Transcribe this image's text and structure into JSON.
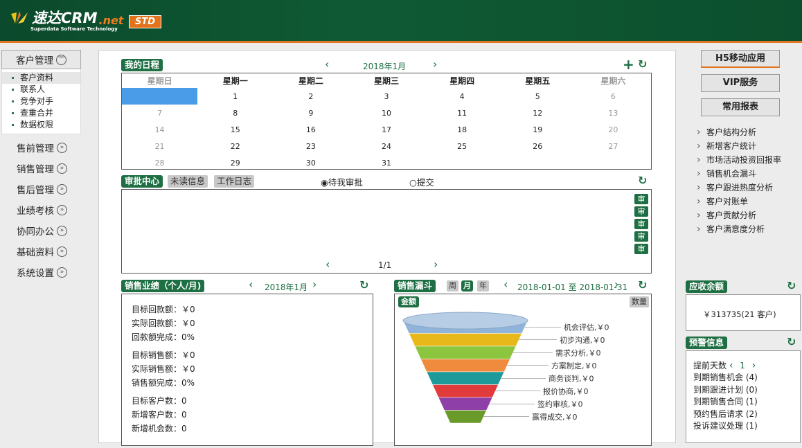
{
  "header": {
    "logo_text": "速达CRM",
    "logo_net": ".net",
    "logo_sub": "Superdata Software Technology",
    "edition": "STD"
  },
  "left_menu": {
    "active": {
      "label": "客户管理"
    },
    "sub_items": [
      {
        "label": "客户资料"
      },
      {
        "label": "联系人"
      },
      {
        "label": "竞争对手"
      },
      {
        "label": "查重合并"
      },
      {
        "label": "数据权限"
      }
    ],
    "items": [
      {
        "label": "售前管理"
      },
      {
        "label": "销售管理"
      },
      {
        "label": "售后管理"
      },
      {
        "label": "业绩考核"
      },
      {
        "label": "协同办公"
      },
      {
        "label": "基础资料"
      },
      {
        "label": "系统设置"
      }
    ]
  },
  "schedule": {
    "title": "我的日程",
    "month": "2018年1月",
    "weekdays": [
      "星期日",
      "星期一",
      "星期二",
      "星期三",
      "星期四",
      "星期五",
      "星期六"
    ],
    "weeks": [
      [
        "",
        "1",
        "2",
        "3",
        "4",
        "5",
        "6"
      ],
      [
        "7",
        "8",
        "9",
        "10",
        "11",
        "12",
        "13"
      ],
      [
        "14",
        "15",
        "16",
        "17",
        "18",
        "19",
        "20"
      ],
      [
        "21",
        "22",
        "23",
        "24",
        "25",
        "26",
        "27"
      ],
      [
        "28",
        "29",
        "30",
        "31",
        "",
        "",
        ""
      ]
    ]
  },
  "approval": {
    "title": "审批中心",
    "tab_unread": "未读信息",
    "tab_log": "工作日志",
    "radio_pending": "待我审批",
    "radio_submit": "提交",
    "shen_label": "审",
    "page": "1/1"
  },
  "sales_perf": {
    "title": "销售业绩（个人/月)",
    "month": "2018年1月",
    "rows": [
      {
        "label": "目标回款额：",
        "value": "￥0"
      },
      {
        "label": "实际回款额：",
        "value": "￥0"
      },
      {
        "label": "回款额完成：",
        "value": "0%"
      },
      {
        "label": "目标销售额：",
        "value": "￥0"
      },
      {
        "label": "实际销售额：",
        "value": "￥0"
      },
      {
        "label": "销售额完成：",
        "value": "0%"
      },
      {
        "label": "目标客户数：",
        "value": "0"
      },
      {
        "label": "新增客户数：",
        "value": "0"
      },
      {
        "label": "新增机会数：",
        "value": "0"
      }
    ]
  },
  "funnel": {
    "title": "销售漏斗",
    "tab_week": "周",
    "tab_month": "月",
    "tab_year": "年",
    "date_from": "2018-01-01",
    "date_sep": "至",
    "date_to": "2018-01-31",
    "btn_amount": "金额",
    "btn_qty": "数量",
    "stages": [
      {
        "label": "机会评估,￥0",
        "color": "#8fb3d9"
      },
      {
        "label": "初步沟通,￥0",
        "color": "#e8b81a"
      },
      {
        "label": "需求分析,￥0",
        "color": "#8cc63e"
      },
      {
        "label": "方案制定,￥0",
        "color": "#f08a3c"
      },
      {
        "label": "商务谈判,￥0",
        "color": "#1f9a9a"
      },
      {
        "label": "报价协商,￥0",
        "color": "#e23b3b"
      },
      {
        "label": "签约审核,￥0",
        "color": "#8e3fa8"
      },
      {
        "label": "赢得成交,￥0",
        "color": "#6a9a2a"
      }
    ]
  },
  "right": {
    "btn_h5": "H5移动应用",
    "btn_vip": "VIP服务",
    "btn_reports": "常用报表",
    "links": [
      {
        "label": "客户结构分析"
      },
      {
        "label": "新增客户统计"
      },
      {
        "label": "市场活动投资回报率"
      },
      {
        "label": "销售机会漏斗"
      },
      {
        "label": "客户跟进热度分析"
      },
      {
        "label": "客户对账单"
      },
      {
        "label": "客户贡献分析"
      },
      {
        "label": "客户满意度分析"
      }
    ],
    "receivable": {
      "title": "应收余额",
      "value": "￥313735(21 客户)"
    },
    "alerts": {
      "title": "预警信息",
      "advance_label": "提前天数",
      "advance_value": "1",
      "items": [
        {
          "label": "到期销售机会 (4)"
        },
        {
          "label": "到期跟进计划 (0)"
        },
        {
          "label": "到期销售合同 (1)"
        },
        {
          "label": "预约售后请求 (2)"
        },
        {
          "label": "投诉建议处理 (1)"
        }
      ]
    }
  }
}
